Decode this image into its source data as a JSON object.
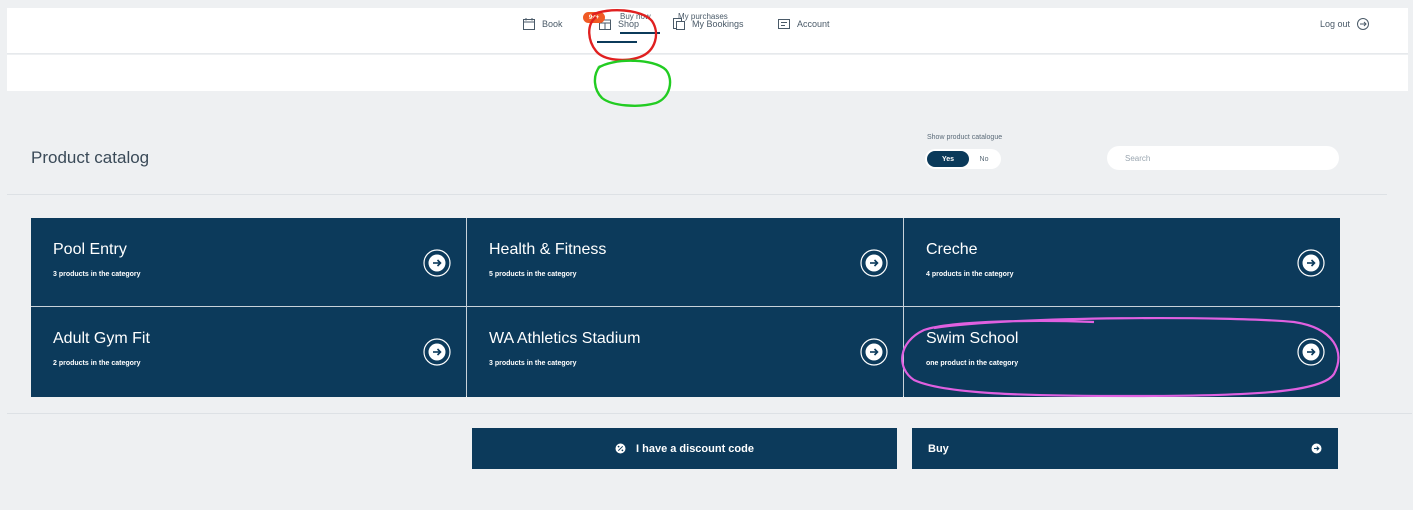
{
  "nav": {
    "items": [
      {
        "label": "Book",
        "icon": "calendar-icon"
      },
      {
        "label": "Shop",
        "icon": "shop-icon"
      },
      {
        "label": "My Bookings",
        "icon": "bookings-icon"
      },
      {
        "label": "Account",
        "icon": "account-icon"
      }
    ],
    "badge": "99+",
    "logout_label": "Log out"
  },
  "subnav": {
    "tabs": [
      {
        "label": "Buy now",
        "active": true
      },
      {
        "label": "My purchases",
        "active": false
      }
    ]
  },
  "catalog": {
    "title": "Product catalog",
    "show_label": "Show product catalogue",
    "toggle_yes": "Yes",
    "toggle_no": "No",
    "search_placeholder": "Search",
    "categories": [
      {
        "name": "Pool Entry",
        "count": "3 products in the category"
      },
      {
        "name": "Health & Fitness",
        "count": "5 products in the category"
      },
      {
        "name": "Creche",
        "count": "4 products in the category"
      },
      {
        "name": "Adult Gym Fit",
        "count": "2 products in the category"
      },
      {
        "name": "WA Athletics Stadium",
        "count": "3 products in the category"
      },
      {
        "name": "Swim School",
        "count": "one product in the category"
      }
    ]
  },
  "actions": {
    "discount_label": "I have a discount code",
    "buy_label": "Buy"
  },
  "colors": {
    "primary": "#0c3a5b",
    "badge": "#f05a24",
    "annotation_red": "#e02020",
    "annotation_green": "#22cc22",
    "annotation_pink": "#e060e0"
  }
}
